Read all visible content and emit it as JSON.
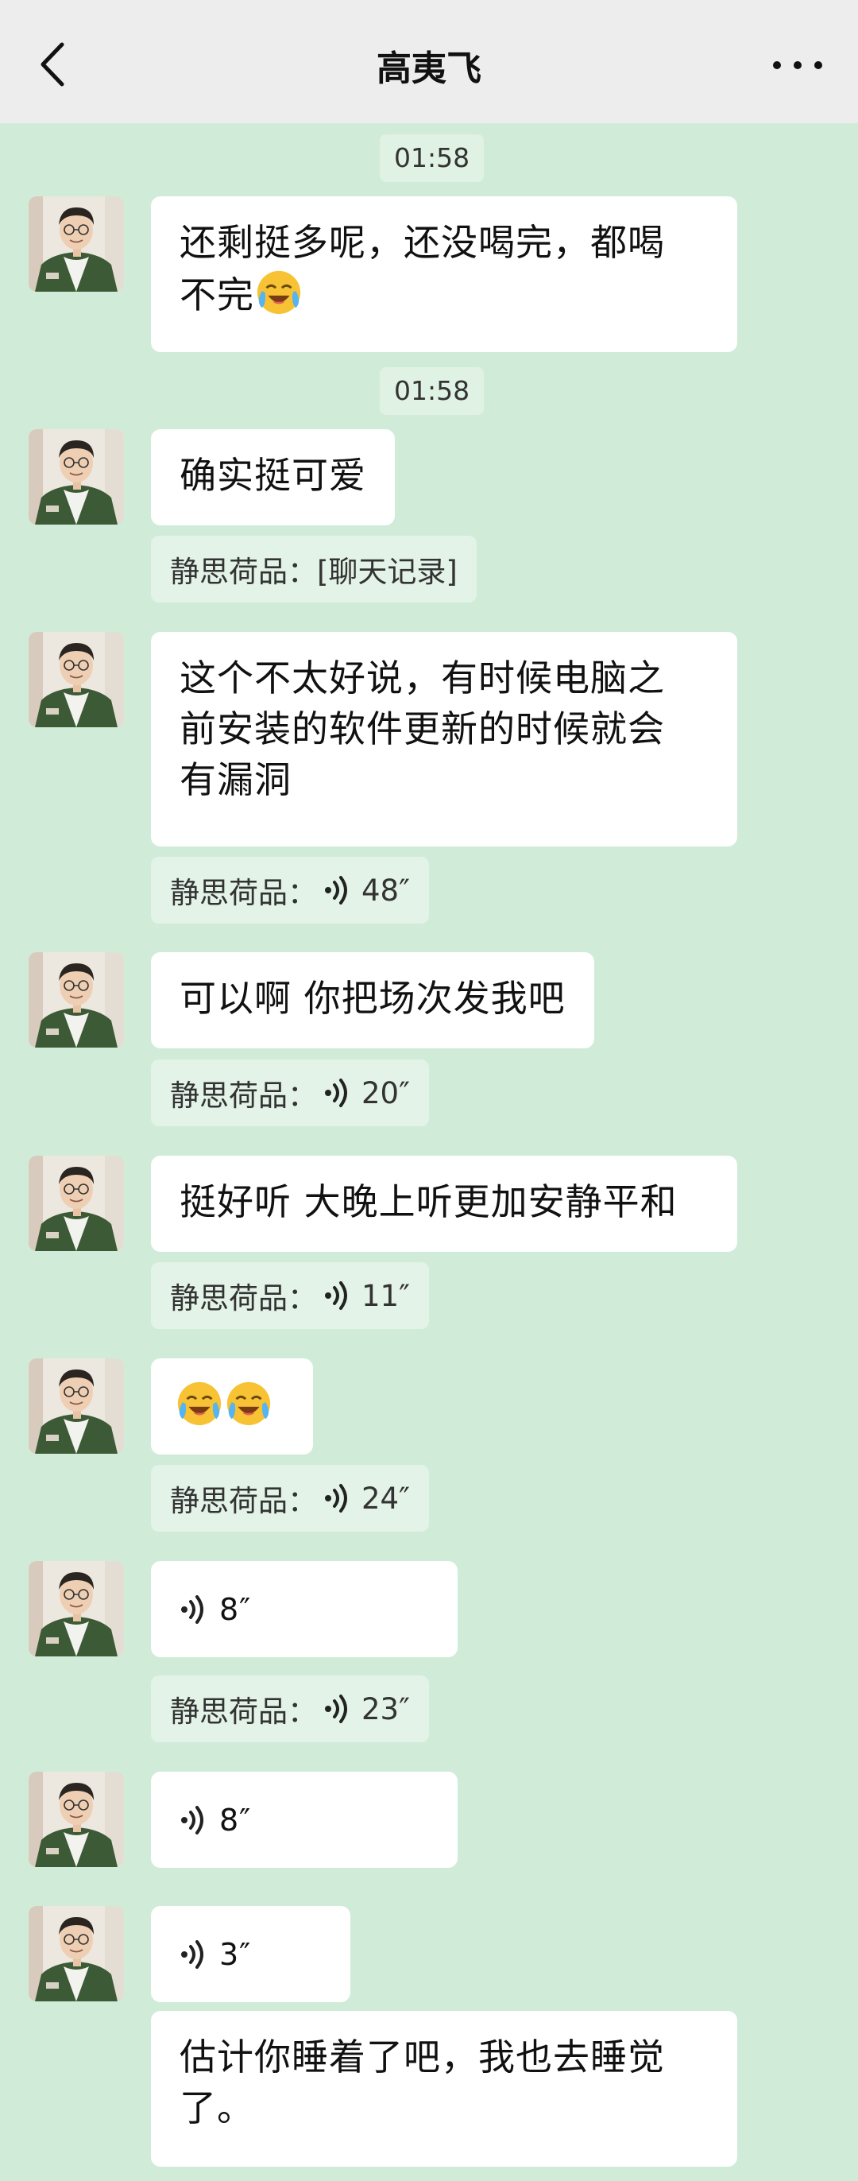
{
  "header": {
    "title": "高夷飞"
  },
  "messages": {
    "ts1": "01:58",
    "m1_line1": "还剩挺多呢，还没喝完，都喝",
    "m1_line2": "不完",
    "ts2": "01:58",
    "m2": "确实挺可爱",
    "q1": "静思荷品：[聊天记录]",
    "m3_line1": "这个不太好说，有时候电脑之",
    "m3_line2": "前安装的软件更新的时候就会",
    "m3_line3": "有漏洞",
    "q2_prefix": "静思荷品：",
    "q2_duration": "48″",
    "m4": "可以啊 你把场次发我吧",
    "q3_prefix": "静思荷品：",
    "q3_duration": "20″",
    "m5": "挺好听 大晚上听更加安静平和",
    "q4_prefix": "静思荷品：",
    "q4_duration": "11″",
    "q5_prefix": "静思荷品：",
    "q5_duration": "24″",
    "v1_duration": "8″",
    "q6_prefix": "静思荷品：",
    "q6_duration": "23″",
    "v2_duration": "8″",
    "v3_duration": "3″",
    "m6_line1": "估计你睡着了吧，我也去睡觉",
    "m6_line2": "了。"
  },
  "icons": {
    "back": "chevron-left-icon",
    "more": "more-dots-icon",
    "emoji": "face-with-tears-of-joy-icon",
    "voice": "voice-wave-icon",
    "avatar": "avatar"
  }
}
